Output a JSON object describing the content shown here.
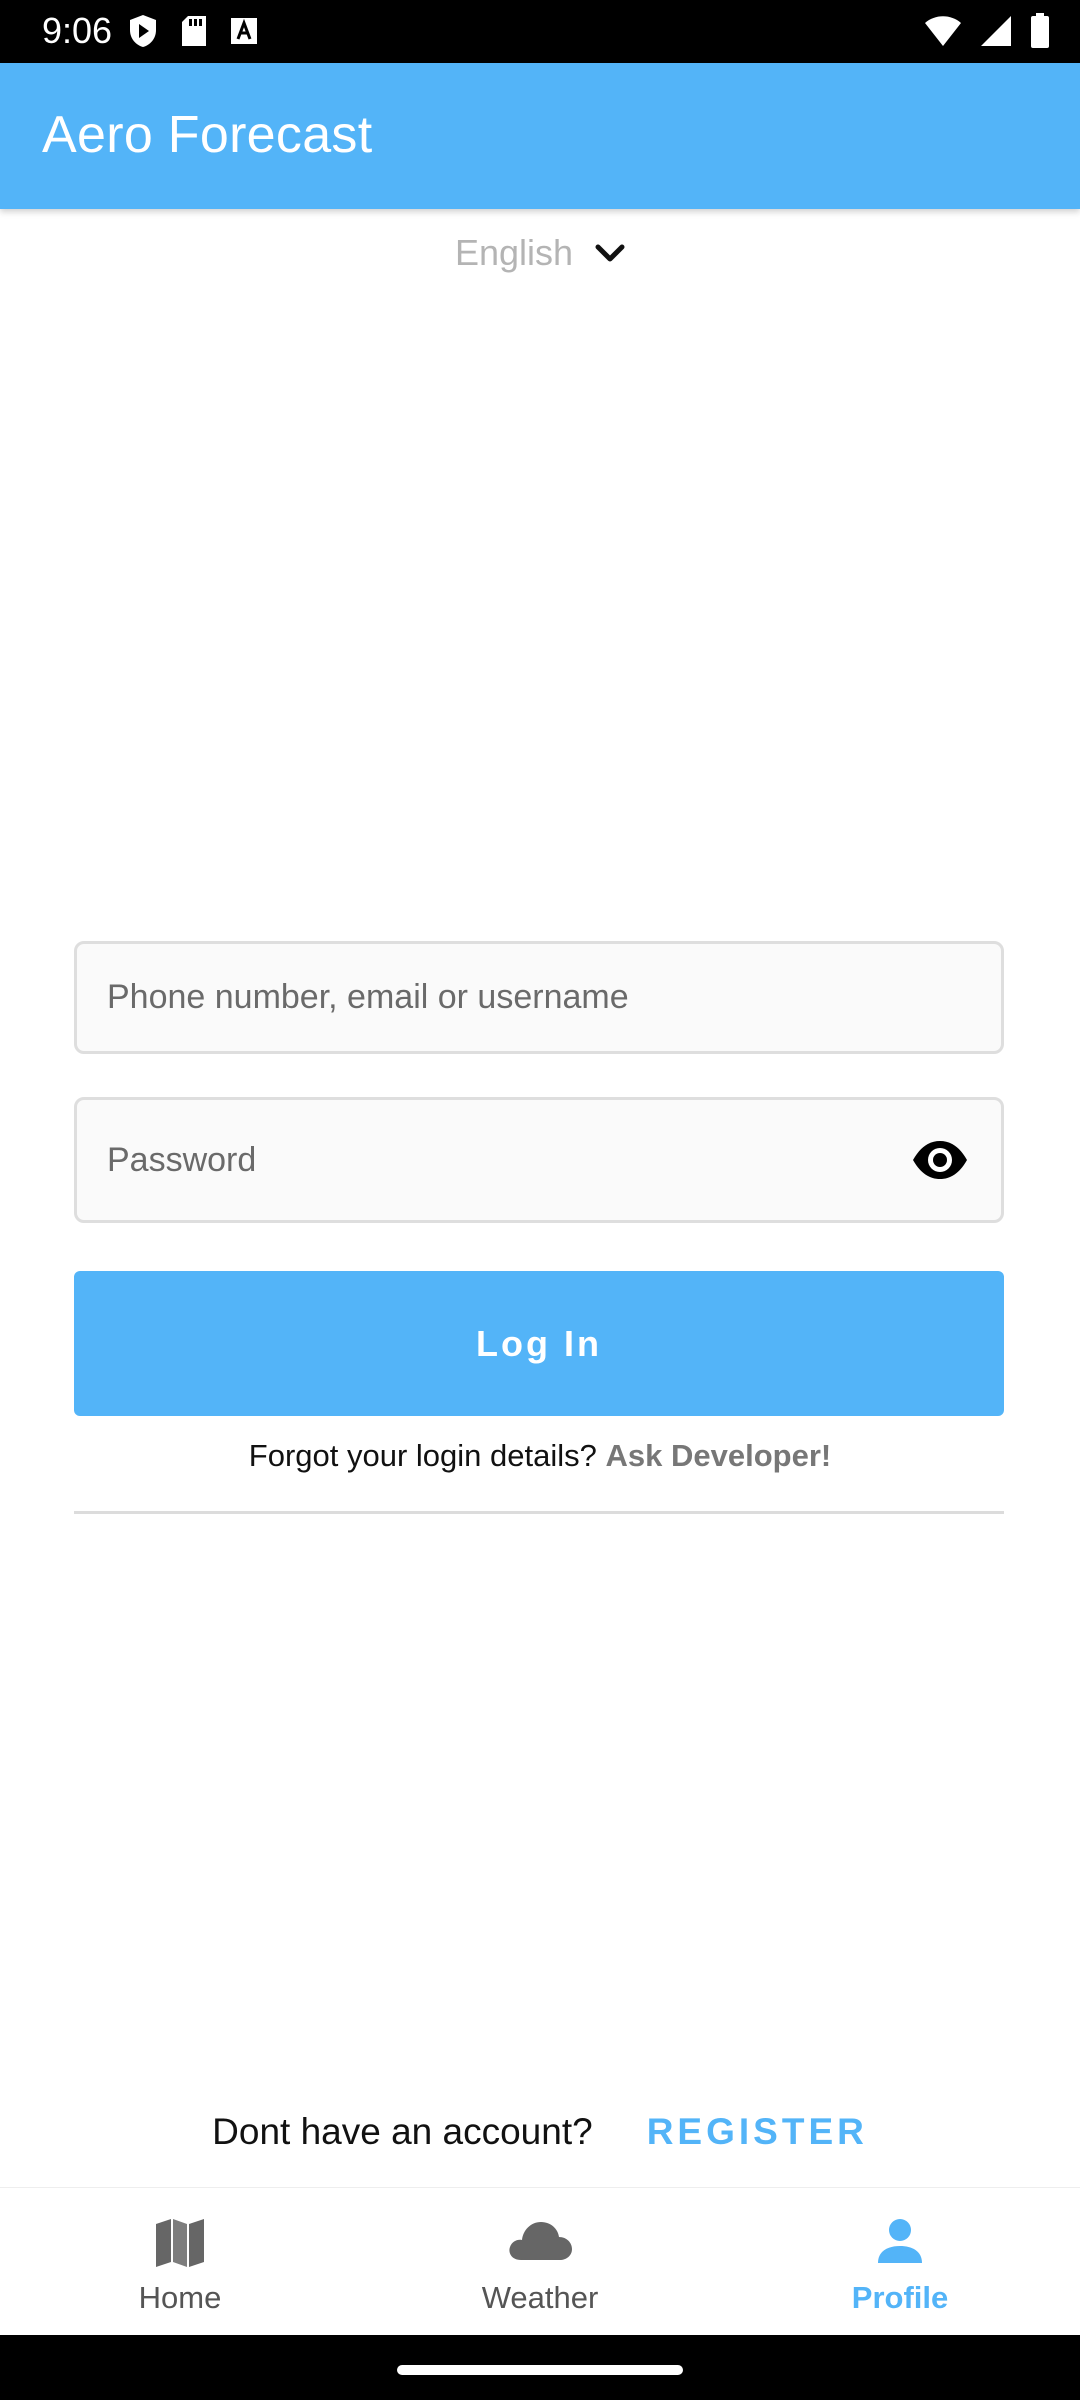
{
  "status_bar": {
    "time": "9:06",
    "left_icons": [
      "shield-play-icon",
      "sd-card-icon",
      "font-a-icon"
    ],
    "right_icons": [
      "wifi-icon",
      "cell-signal-icon",
      "battery-icon"
    ]
  },
  "app_bar": {
    "title": "Aero Forecast"
  },
  "language": {
    "selected": "English",
    "icon": "chevron-down-icon"
  },
  "login_form": {
    "username_placeholder": "Phone number, email or username",
    "username_value": "",
    "password_placeholder": "Password",
    "password_value": "",
    "toggle_visibility_icon": "eye-icon",
    "login_label": "Log In",
    "forgot_text": "Forgot your login details?",
    "forgot_link": "Ask Developer!"
  },
  "register": {
    "question": "Dont have an account?",
    "button_label": "REGISTER"
  },
  "bottom_nav": {
    "items": [
      {
        "label": "Home",
        "icon": "map-icon",
        "active": false
      },
      {
        "label": "Weather",
        "icon": "cloud-icon",
        "active": false
      },
      {
        "label": "Profile",
        "icon": "person-icon",
        "active": true
      }
    ]
  },
  "colors": {
    "primary": "#53b4f8",
    "status_bar": "#000000",
    "background": "#ffffff",
    "link_gray": "#777777"
  }
}
